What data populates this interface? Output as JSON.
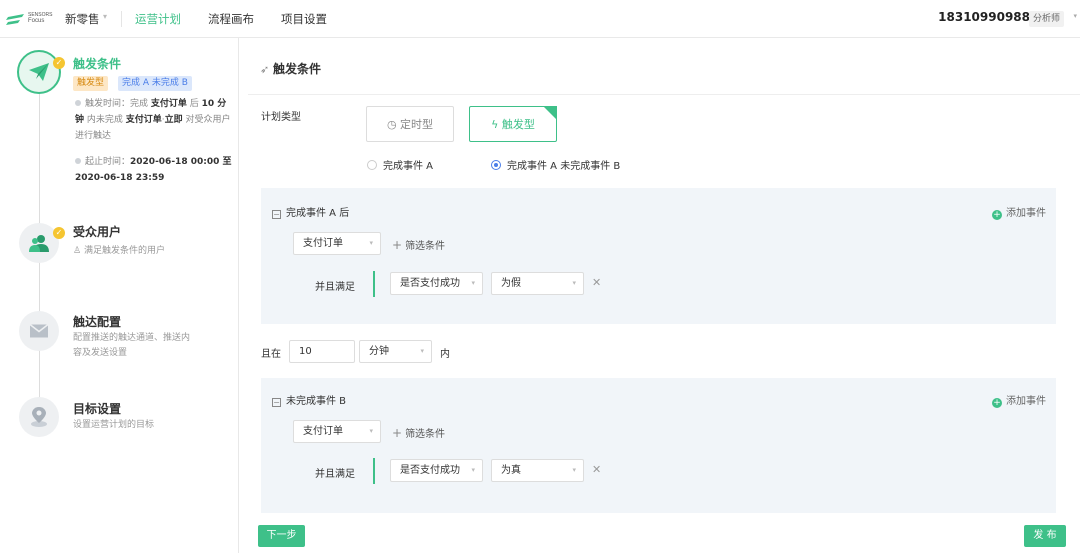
{
  "brand": {
    "line1": "SENSORS",
    "line2": "Focus"
  },
  "nav": {
    "project": "新零售",
    "items": [
      "运营计划",
      "流程画布",
      "项目设置"
    ]
  },
  "user": {
    "phone": "18310990988",
    "role": "分析师"
  },
  "steps": [
    {
      "title": "触发条件",
      "tags": [
        "触发型",
        "完成 A 未完成 B"
      ],
      "detail1": {
        "p1": "触发时间：完成 ",
        "b1": "支付订单",
        "p2": " 后 ",
        "b2": "10 分钟",
        "p3": " 内未完成 ",
        "b3": "支付订单",
        "p4": "·",
        "b4": "立即",
        "p5": " 对受众用户进行触达"
      },
      "detail2": {
        "label": "起止时间：",
        "value": "2020-06-18 00:00 至 2020-06-18 23:59"
      }
    },
    {
      "title": "受众用户",
      "desc": "满足触发条件的用户"
    },
    {
      "title": "触达配置",
      "desc": "配置推送的触达通道、推送内容及发送设置"
    },
    {
      "title": "目标设置",
      "desc": "设置运营计划的目标"
    }
  ],
  "main": {
    "title": "触发条件",
    "plan_type_label": "计划类型",
    "type_scheduled": "定时型",
    "type_triggered": "触发型",
    "radio_a": "完成事件 A",
    "radio_ab": "完成事件 A 未完成事件 B",
    "panel_a": {
      "title": "完成事件 A 后",
      "add": "添加事件",
      "event": "支付订单",
      "filter": "筛选条件",
      "and": "并且满足",
      "prop": "是否支付成功",
      "value": "为假"
    },
    "within": {
      "prefix": "且在",
      "num": "10",
      "unit": "分钟",
      "suffix": "内"
    },
    "panel_b": {
      "title": "未完成事件 B",
      "add": "添加事件",
      "event": "支付订单",
      "filter": "筛选条件",
      "and": "并且满足",
      "prop": "是否支付成功",
      "value": "为真"
    },
    "next": "下一步",
    "publish": "发 布"
  },
  "colors": {
    "accent": "#3ec089",
    "blue": "#4b7ee8",
    "orange": "#f5c531"
  }
}
